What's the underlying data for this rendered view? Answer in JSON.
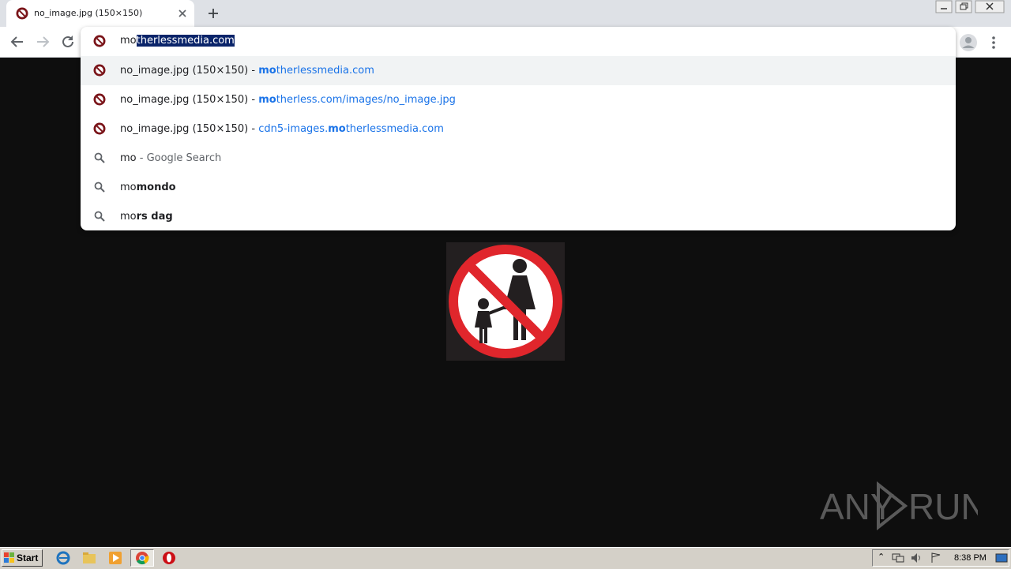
{
  "tab": {
    "title": "no_image.jpg (150×150)",
    "favicon": "motherless-icon"
  },
  "omnibox": {
    "typed_prefix": "mo",
    "autocomplete_selected": "therlessmedia.com",
    "suggestions": [
      {
        "type": "url",
        "icon": "motherless-icon",
        "title": "no_image.jpg (150×150)",
        "sep": " - ",
        "match": "mo",
        "rest": "therlessmedia.com",
        "pre": ""
      },
      {
        "type": "url",
        "icon": "motherless-icon",
        "title": "no_image.jpg (150×150)",
        "sep": " - ",
        "match": "mo",
        "rest": "therless.com/images/no_image.jpg",
        "pre": ""
      },
      {
        "type": "url",
        "icon": "motherless-icon",
        "title": "no_image.jpg (150×150)",
        "sep": " - ",
        "match": "mo",
        "rest": "therlessmedia.com",
        "pre": "cdn5-images."
      },
      {
        "type": "search",
        "icon": "search-icon",
        "query": "mo",
        "suffix": " - Google Search"
      },
      {
        "type": "search",
        "icon": "search-icon",
        "query": "mo",
        "completion": "mondo"
      },
      {
        "type": "search",
        "icon": "search-icon",
        "query": "mo",
        "completion": "rs dag"
      }
    ]
  },
  "taskbar": {
    "start_label": "Start",
    "clock": "8:38 PM"
  },
  "watermark": {
    "text": "ANY RUN"
  },
  "colors": {
    "accent": "#1a73e8",
    "selection": "#0a246a",
    "page_bg": "#0e0e0e",
    "prohibited_red": "#e0262c"
  }
}
